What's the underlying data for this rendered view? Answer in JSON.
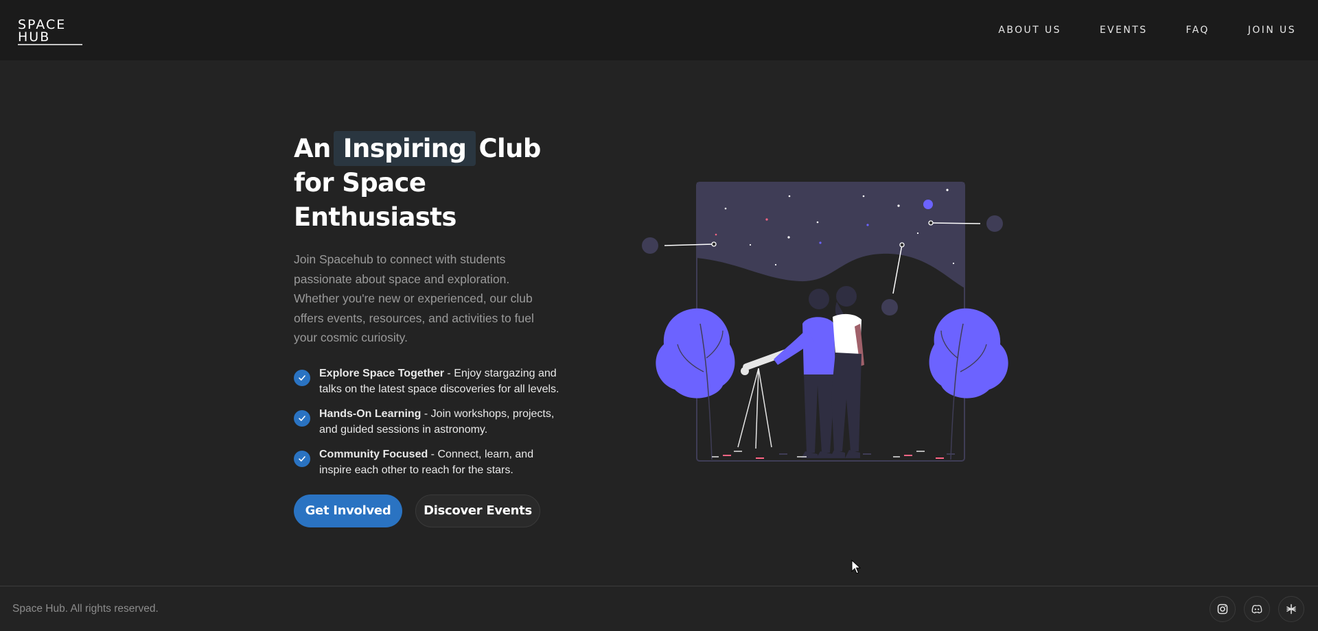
{
  "brand": {
    "logo_text_top": "SPACE",
    "logo_text_bottom": "HUB"
  },
  "nav": {
    "items": [
      {
        "label": "ABOUT US"
      },
      {
        "label": "EVENTS"
      },
      {
        "label": "FAQ"
      },
      {
        "label": "JOIN US"
      }
    ]
  },
  "hero": {
    "headline_prefix": "An",
    "headline_highlight": "Inspiring",
    "headline_suffix": "Club",
    "headline_line2": "for Space Enthusiasts",
    "intro": "Join Spacehub to connect with students passionate about space and exploration. Whether you're new or experienced, our club offers events, resources, and activities to fuel your cosmic curiosity.",
    "features": [
      {
        "title": "Explore Space Together",
        "text": " - Enjoy stargazing and talks on the latest space discoveries for all levels."
      },
      {
        "title": "Hands-On Learning",
        "text": " - Join workshops, projects, and guided sessions in astronomy."
      },
      {
        "title": "Community Focused",
        "text": " - Connect, learn, and inspire each other to reach for the stars."
      }
    ],
    "primary_button": "Get Involved",
    "secondary_button": "Discover Events"
  },
  "footer": {
    "copyright": "Space Hub. All rights reserved.",
    "socials": [
      "instagram-icon",
      "discord-icon",
      "linktree-icon"
    ]
  },
  "colors": {
    "accent_blue": "#2a73c2",
    "illustration_purple": "#6c63ff",
    "night_sky": "#3f3d56",
    "header_bg": "#1b1b1b",
    "page_bg": "#232323"
  }
}
